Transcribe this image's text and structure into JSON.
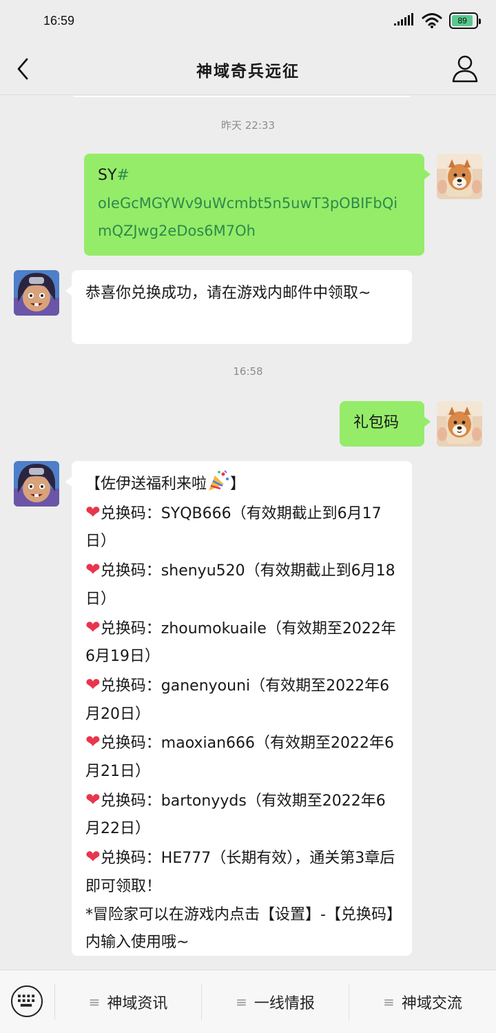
{
  "status_bar": {
    "time": "16:59",
    "battery": "89",
    "battery_level": 0.89,
    "accent": "#58c98e"
  },
  "header": {
    "title": "神域奇兵远征"
  },
  "messages": {
    "timestamp_1": "昨天 22:33",
    "sent_code": {
      "prefix": "SY",
      "hash": "#",
      "code": "oIeGcMGYWv9uWcmbt5n5uwT3pOBIFbQimQZJwg2eDos6M7Oh"
    },
    "reply_1": "恭喜你兑换成功，请在游戏内邮件中领取~",
    "timestamp_2": "16:58",
    "sent_2": "礼包码",
    "gift": {
      "title": "【佐伊送福利来啦",
      "title_end": "】",
      "entries": [
        "兑换码：SYQB666（有效期截止到6月17日）",
        "兑换码：shenyu520（有效期截止到6月18日）",
        "兑换码：zhoumokuaile（有效期至2022年6月19日）",
        "兑换码：ganenyouni（有效期至2022年6月20日）",
        "兑换码：maoxian666（有效期至2022年6月21日）",
        "兑换码：bartonyyds（有效期至2022年6月22日）",
        "兑换码：HE777（长期有效），通关第3章后即可领取！"
      ],
      "footer": "*冒险家可以在游戏内点击【设置】-【兑换码】内输入使用哦~"
    }
  },
  "bottom_menu": {
    "items": [
      "神域资讯",
      "一线情报",
      "神域交流"
    ]
  },
  "colors": {
    "sent_bubble": "#95ec69",
    "received_bubble": "#ffffff",
    "code_link": "#2c8a4b",
    "heart": "#e8354c"
  },
  "icons": [
    "back-arrow-icon",
    "profile-icon",
    "keyboard-icon",
    "menu-lines-icon",
    "heart-icon",
    "party-popper-icon"
  ]
}
